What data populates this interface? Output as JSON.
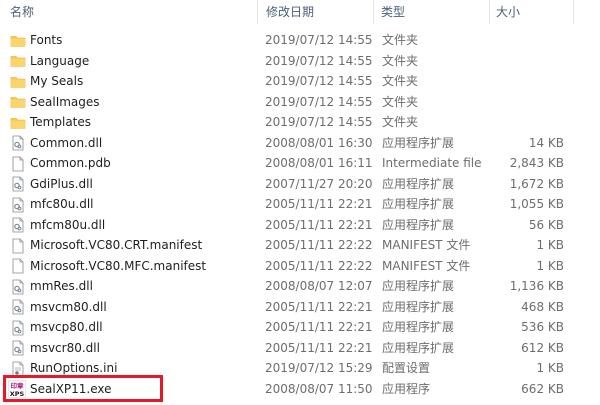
{
  "columns": {
    "name": "名称",
    "date": "修改日期",
    "type": "类型",
    "size": "大小"
  },
  "files": [
    {
      "name": "Fonts",
      "date": "2019/07/12 14:55",
      "type": "文件夹",
      "size": "",
      "icon": "folder-icon"
    },
    {
      "name": "Language",
      "date": "2019/07/12 14:55",
      "type": "文件夹",
      "size": "",
      "icon": "folder-icon"
    },
    {
      "name": "My Seals",
      "date": "2019/07/12 14:55",
      "type": "文件夹",
      "size": "",
      "icon": "folder-icon"
    },
    {
      "name": "SealImages",
      "date": "2019/07/12 14:55",
      "type": "文件夹",
      "size": "",
      "icon": "folder-icon"
    },
    {
      "name": "Templates",
      "date": "2019/07/12 14:55",
      "type": "文件夹",
      "size": "",
      "icon": "folder-icon"
    },
    {
      "name": "Common.dll",
      "date": "2008/08/01 16:30",
      "type": "应用程序扩展",
      "size": "14 KB",
      "icon": "dll-file-icon"
    },
    {
      "name": "Common.pdb",
      "date": "2008/08/01 16:11",
      "type": "Intermediate file",
      "size": "2,843 KB",
      "icon": "document-file-icon"
    },
    {
      "name": "GdiPlus.dll",
      "date": "2007/11/27 20:20",
      "type": "应用程序扩展",
      "size": "1,672 KB",
      "icon": "dll-file-icon"
    },
    {
      "name": "mfc80u.dll",
      "date": "2005/11/11 22:21",
      "type": "应用程序扩展",
      "size": "1,055 KB",
      "icon": "dll-file-icon"
    },
    {
      "name": "mfcm80u.dll",
      "date": "2005/11/11 22:21",
      "type": "应用程序扩展",
      "size": "56 KB",
      "icon": "dll-file-icon"
    },
    {
      "name": "Microsoft.VC80.CRT.manifest",
      "date": "2005/11/11 22:22",
      "type": "MANIFEST 文件",
      "size": "1 KB",
      "icon": "document-file-icon"
    },
    {
      "name": "Microsoft.VC80.MFC.manifest",
      "date": "2005/11/11 22:22",
      "type": "MANIFEST 文件",
      "size": "1 KB",
      "icon": "document-file-icon"
    },
    {
      "name": "mmRes.dll",
      "date": "2008/08/07 12:07",
      "type": "应用程序扩展",
      "size": "1,136 KB",
      "icon": "dll-file-icon"
    },
    {
      "name": "msvcm80.dll",
      "date": "2005/11/11 22:21",
      "type": "应用程序扩展",
      "size": "468 KB",
      "icon": "dll-file-icon"
    },
    {
      "name": "msvcp80.dll",
      "date": "2005/11/11 22:21",
      "type": "应用程序扩展",
      "size": "536 KB",
      "icon": "dll-file-icon"
    },
    {
      "name": "msvcr80.dll",
      "date": "2005/11/11 22:21",
      "type": "应用程序扩展",
      "size": "612 KB",
      "icon": "dll-file-icon"
    },
    {
      "name": "RunOptions.ini",
      "date": "2019/07/12 15:29",
      "type": "配置设置",
      "size": "1 KB",
      "icon": "settings-file-icon"
    },
    {
      "name": "SealXP11.exe",
      "date": "2008/08/07 11:50",
      "type": "应用程序",
      "size": "662 KB",
      "icon": "sealxp-app-icon"
    }
  ],
  "exe_icon_text": {
    "top": "印章",
    "bottom": "XPS"
  },
  "colors": {
    "folder": "#f6c94e",
    "highlight_border": "#e8182b",
    "header_text": "#4c607a"
  }
}
